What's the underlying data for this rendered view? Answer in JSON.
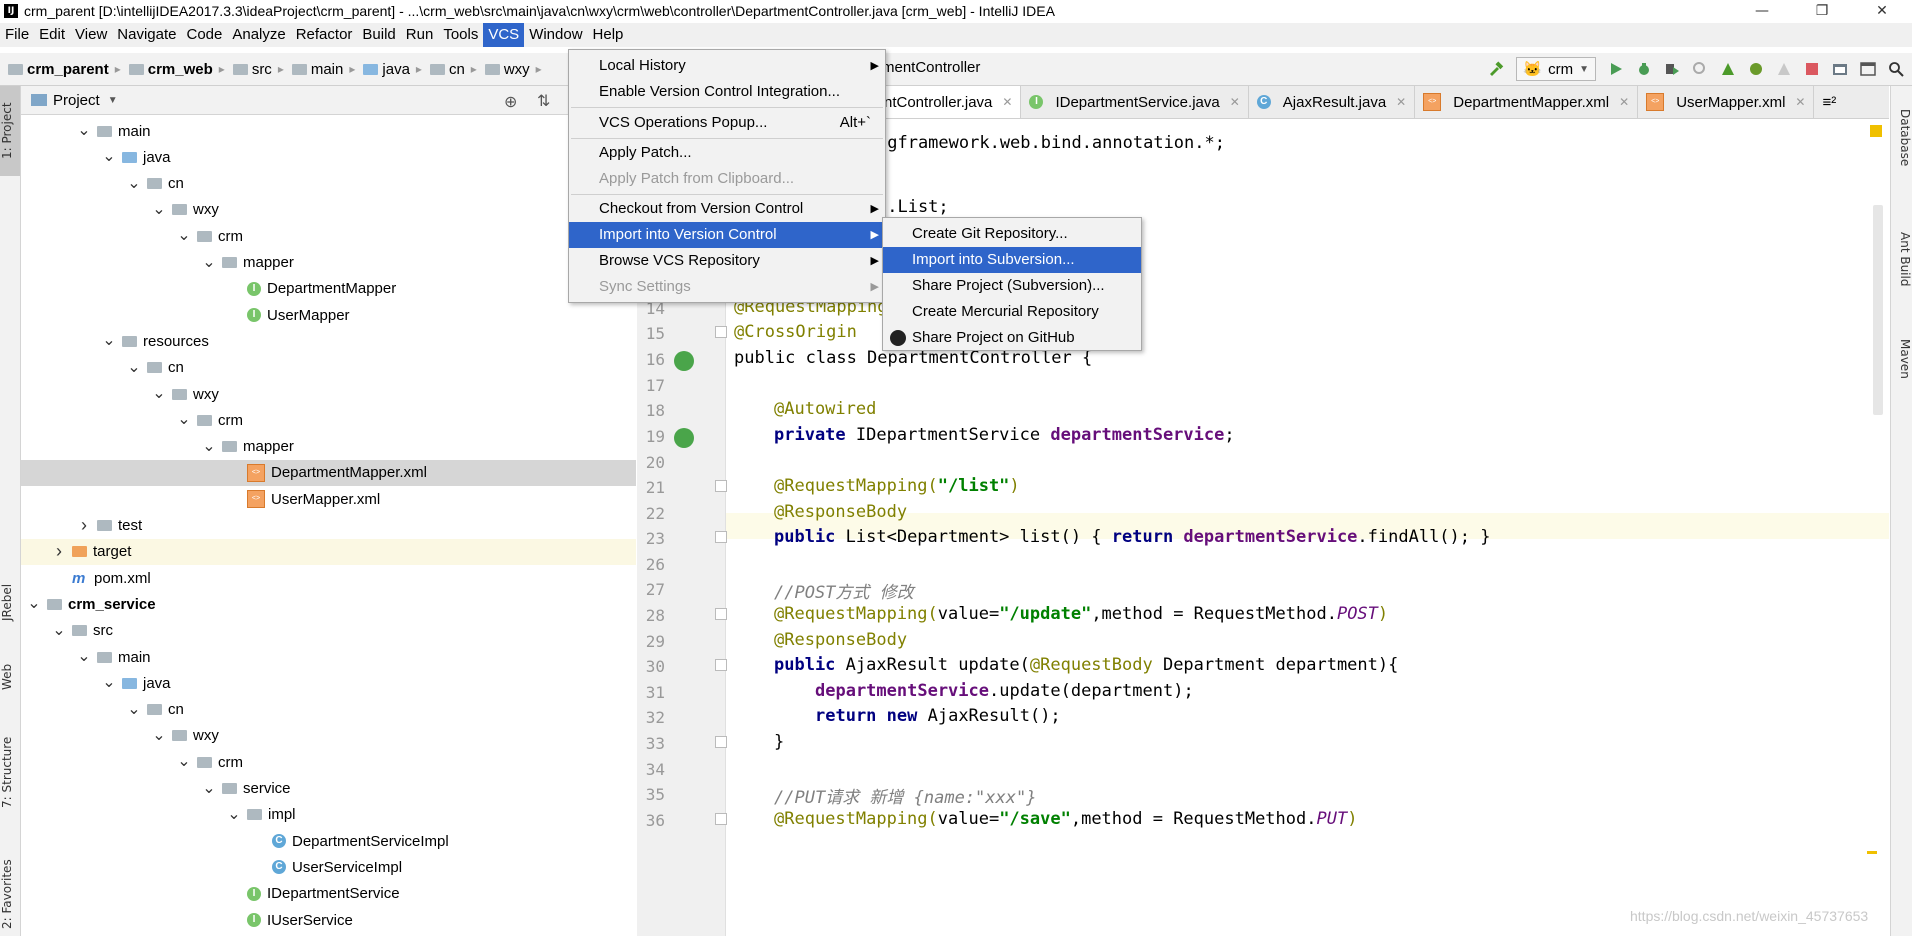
{
  "window": {
    "title": "crm_parent [D:\\intellijIDEA2017.3.3\\ideaProject\\crm_parent] - ...\\crm_web\\src\\main\\java\\cn\\wxy\\crm\\web\\controller\\DepartmentController.java [crm_web] - IntelliJ IDEA",
    "minimize": "—",
    "maximize": "❐",
    "close": "✕"
  },
  "menubar": [
    "File",
    "Edit",
    "View",
    "Navigate",
    "Code",
    "Analyze",
    "Refactor",
    "Build",
    "Run",
    "Tools",
    "VCS",
    "Window",
    "Help"
  ],
  "navbar": {
    "crumbs": [
      "crm_parent",
      "crm_web",
      "src",
      "main",
      "java",
      "cn",
      "wxy"
    ],
    "current_file": "mentController",
    "run_config": "crm"
  },
  "left_stripe": {
    "project": "1: Project",
    "jrebel": "JRebel",
    "web": "Web",
    "structure": "7: Structure",
    "favorites": "2: Favorites"
  },
  "project_panel": {
    "title": "Project"
  },
  "tree": [
    {
      "label": "main",
      "depth": 3,
      "type": "folder",
      "arrow": "v"
    },
    {
      "label": "java",
      "depth": 4,
      "type": "folder-blue",
      "arrow": "v"
    },
    {
      "label": "cn",
      "depth": 5,
      "type": "folder",
      "arrow": "v"
    },
    {
      "label": "wxy",
      "depth": 6,
      "type": "folder",
      "arrow": "v"
    },
    {
      "label": "crm",
      "depth": 7,
      "type": "folder",
      "arrow": "v"
    },
    {
      "label": "mapper",
      "depth": 8,
      "type": "folder",
      "arrow": "v"
    },
    {
      "label": "DepartmentMapper",
      "depth": 9,
      "type": "interface",
      "arrow": ""
    },
    {
      "label": "UserMapper",
      "depth": 9,
      "type": "interface",
      "arrow": ""
    },
    {
      "label": "resources",
      "depth": 4,
      "type": "folder",
      "arrow": "v"
    },
    {
      "label": "cn",
      "depth": 5,
      "type": "folder",
      "arrow": "v"
    },
    {
      "label": "wxy",
      "depth": 6,
      "type": "folder",
      "arrow": "v"
    },
    {
      "label": "crm",
      "depth": 7,
      "type": "folder",
      "arrow": "v"
    },
    {
      "label": "mapper",
      "depth": 8,
      "type": "folder",
      "arrow": "v"
    },
    {
      "label": "DepartmentMapper.xml",
      "depth": 9,
      "type": "xml",
      "arrow": "",
      "selected": true
    },
    {
      "label": "UserMapper.xml",
      "depth": 9,
      "type": "xml",
      "arrow": ""
    },
    {
      "label": "test",
      "depth": 3,
      "type": "folder",
      "arrow": ">"
    },
    {
      "label": "target",
      "depth": 2,
      "type": "folder-orange",
      "arrow": ">",
      "yellow": true
    },
    {
      "label": "pom.xml",
      "depth": 2,
      "type": "maven",
      "arrow": ""
    },
    {
      "label": "crm_service",
      "depth": 1,
      "type": "module",
      "arrow": "v",
      "bold": true
    },
    {
      "label": "src",
      "depth": 2,
      "type": "folder",
      "arrow": "v"
    },
    {
      "label": "main",
      "depth": 3,
      "type": "folder",
      "arrow": "v"
    },
    {
      "label": "java",
      "depth": 4,
      "type": "folder-blue",
      "arrow": "v"
    },
    {
      "label": "cn",
      "depth": 5,
      "type": "folder",
      "arrow": "v"
    },
    {
      "label": "wxy",
      "depth": 6,
      "type": "folder",
      "arrow": "v"
    },
    {
      "label": "crm",
      "depth": 7,
      "type": "folder",
      "arrow": "v"
    },
    {
      "label": "service",
      "depth": 8,
      "type": "folder",
      "arrow": "v"
    },
    {
      "label": "impl",
      "depth": 9,
      "type": "folder",
      "arrow": "v"
    },
    {
      "label": "DepartmentServiceImpl",
      "depth": 10,
      "type": "class",
      "arrow": ""
    },
    {
      "label": "UserServiceImpl",
      "depth": 10,
      "type": "class",
      "arrow": ""
    },
    {
      "label": "IDepartmentService",
      "depth": 9,
      "type": "interface",
      "arrow": ""
    },
    {
      "label": "IUserService",
      "depth": 9,
      "type": "interface",
      "arrow": ""
    }
  ],
  "tabs": [
    {
      "label": "ntController.java",
      "icon": "C",
      "active": true
    },
    {
      "label": "IDepartmentService.java",
      "icon": "I"
    },
    {
      "label": "AjaxResult.java",
      "icon": "C"
    },
    {
      "label": "DepartmentMapper.xml",
      "icon": "xml"
    },
    {
      "label": "UserMapper.xml",
      "icon": "xml"
    },
    {
      "label": "≡²",
      "icon": ""
    }
  ],
  "right_stripe": {
    "database": "Database",
    "ant": "Ant Build",
    "maven": "Maven"
  },
  "code": {
    "l_import": "ngframework.web.bind.annotation.*;",
    "l_list": "l.List;",
    "l14": "@RequestMapping(",
    "l15": "@CrossOrigin",
    "l16": "public class DepartmentController {",
    "l18": "@Autowired",
    "l19_kw": "private",
    "l19_t": " IDepartmentService ",
    "l19_f": "departmentService",
    "l21_a": "@RequestMapping(",
    "l21_s": "\"/list\"",
    "l21_e": ")",
    "l22": "@ResponseBody",
    "l23_kw": "public",
    "l23_a": " List<Department> list() { ",
    "l23_r": "return",
    "l23_f": " departmentService",
    "l23_e": ".findAll(); }",
    "l27": "//POST方式 修改",
    "l28_a": "@RequestMapping(",
    "l28_b": "value=",
    "l28_s": "\"/update\"",
    "l28_c": ",method = RequestMethod.",
    "l28_st": "POST",
    "l28_e": ")",
    "l29": "@ResponseBody",
    "l30_kw": "public",
    "l30_a": " AjaxResult update(",
    "l30_ann": "@RequestBody",
    "l30_e": " Department department){",
    "l31_f": "departmentService",
    "l31_e": ".update(department);",
    "l32_kw1": "return",
    "l32_kw2": " new",
    "l32_e": " AjaxResult();",
    "l33": "}",
    "l35": "//PUT请求 新增 {name:\"xxx\"}",
    "l36_a": "@RequestMapping(",
    "l36_b": "value=",
    "l36_s": "\"/save\"",
    "l36_c": ",method = RequestMethod.",
    "l36_st": "PUT",
    "l36_e": ")"
  },
  "line_numbers": {
    "r14": "14",
    "r15": "15",
    "r16": "16",
    "r17": "17",
    "r18": "18",
    "r19": "19",
    "r20": "20",
    "r21": "21",
    "r22": "22",
    "r23": "23",
    "r26": "26",
    "r27": "27",
    "r28": "28",
    "r29": "29",
    "r30": "30",
    "r31": "31",
    "r32": "32",
    "r33": "33",
    "r34": "34",
    "r35": "35",
    "r36": "36"
  },
  "vcs_menu": [
    {
      "label": "Local History",
      "submenu": true
    },
    {
      "label": "Enable Version Control Integration..."
    },
    {
      "sep": true
    },
    {
      "label": "VCS Operations Popup...",
      "shortcut": "Alt+`"
    },
    {
      "sep": true
    },
    {
      "label": "Apply Patch..."
    },
    {
      "label": "Apply Patch from Clipboard...",
      "disabled": true
    },
    {
      "sep": true
    },
    {
      "label": "Checkout from Version Control",
      "submenu": true
    },
    {
      "label": "Import into Version Control",
      "submenu": true,
      "highlighted": true
    },
    {
      "label": "Browse VCS Repository",
      "submenu": true
    },
    {
      "label": "Sync Settings",
      "submenu": true,
      "disabled": true
    }
  ],
  "import_submenu": [
    {
      "label": "Create Git Repository..."
    },
    {
      "label": "Import into Subversion...",
      "highlighted": true
    },
    {
      "label": "Share Project (Subversion)..."
    },
    {
      "label": "Create Mercurial Repository"
    },
    {
      "label": "Share Project on GitHub",
      "github": true
    }
  ],
  "watermark": "https://blog.csdn.net/weixin_45737653",
  "colors": {
    "menu_highlight": "#2f65ca",
    "selected_row": "#d6d6d6",
    "interface_icon": "#79c56a",
    "class_icon": "#5fa7d7"
  }
}
